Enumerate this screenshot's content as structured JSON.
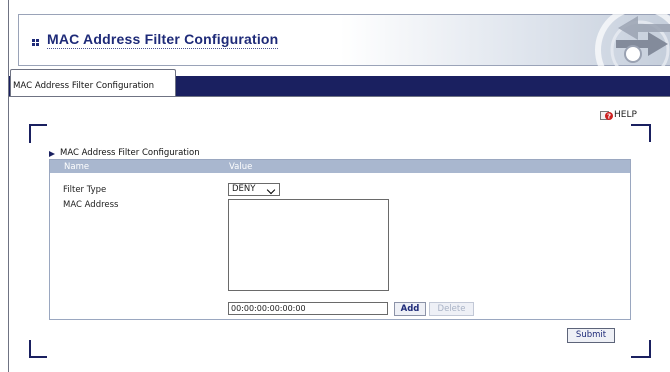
{
  "header": {
    "title": "MAC Address Filter Configuration",
    "icon": "arrows-icon"
  },
  "tabs": [
    {
      "label": "MAC Address Filter Configuration",
      "active": true
    }
  ],
  "help": {
    "label": "HELP",
    "icon": "help-icon"
  },
  "section": {
    "title": "MAC Address Filter Configuration",
    "columns": {
      "name": "Name",
      "value": "Value"
    }
  },
  "form": {
    "filter_type": {
      "label": "Filter Type",
      "value": "DENY"
    },
    "mac_address": {
      "label": "MAC Address",
      "input_value": "00:00:00:00:00:00",
      "list_items": []
    },
    "add_label": "Add",
    "delete_label": "Delete",
    "submit_label": "Submit"
  },
  "colors": {
    "navy": "#1a2060",
    "header_blue": "#a9b7cf",
    "title_blue": "#1e2a78"
  }
}
